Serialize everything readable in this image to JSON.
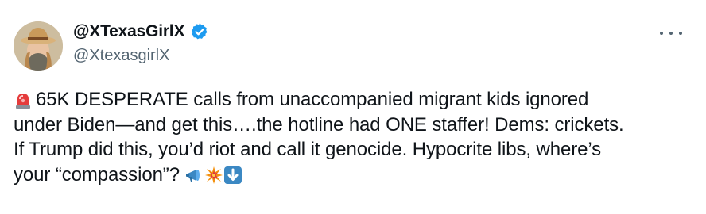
{
  "author": {
    "display_name": "@XTexasGirlX",
    "handle": "@XtexasgirlX",
    "verified": true,
    "verified_color": "#1d9bf0",
    "avatar_icon": "avatar-photo"
  },
  "tweet": {
    "lead_emoji": "police-car-light-emoji",
    "lines": [
      "65K DESPERATE calls from unaccompanied migrant kids ignored",
      "under Biden—and get this….the hotline had ONE staffer! Dems: crickets.",
      "If Trump did this, you’d riot and call it genocide. Hypocrite libs, where’s",
      "your “compassion”? "
    ],
    "trailing_emojis": [
      "megaphone-emoji",
      "collision-emoji",
      "down-arrow-emoji"
    ]
  },
  "menu": {
    "more_icon": "more-dots-icon"
  }
}
